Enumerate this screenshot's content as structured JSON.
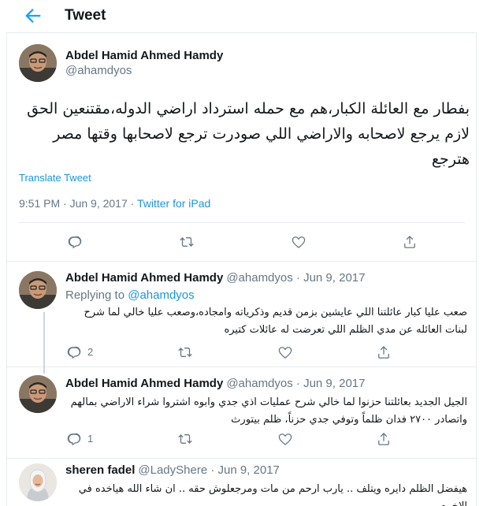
{
  "header": {
    "title": "Tweet"
  },
  "main_tweet": {
    "author_name": "Abdel Hamid Ahmed Hamdy",
    "author_handle": "@ahamdyos",
    "text": "بفطار مع العائلة الكبار،هم مع حمله استرداد اراضي الدوله،مقتنعين الحق لازم يرجع لاصحابه والاراضي اللي صودرت ترجع لاصحابها وقتها مصر هترجع",
    "translate_label": "Translate Tweet",
    "timestamp": "9:51 PM · Jun 9, 2017 · ",
    "source": "Twitter for iPad"
  },
  "replies": [
    {
      "author_name": "Abdel Hamid Ahmed Hamdy",
      "author_handle": "@ahamdyos",
      "date": " · Jun 9, 2017",
      "replying_prefix": "Replying to ",
      "replying_to": "@ahamdyos",
      "text": "صعب عليا كبار عائلتنا اللي عايشين بزمن قديم وذكرياته وامجاده،وصعب عليا خالي لما شرح لبنات العائله عن مدي الظلم اللي تعرضت له عائلات كتيره",
      "reply_count": "2"
    },
    {
      "author_name": "Abdel Hamid Ahmed Hamdy",
      "author_handle": "@ahamdyos",
      "date": " · Jun 9, 2017",
      "text": "الجيل الجديد بعائلتنا حزنوا لما خالي شرح عمليات اذي جدي وابوه اشتروا شراء الاراضي بمالهم واتصادر ٢٧٠٠ فدان ظلماً وتوفي جدي حزناً، ظلم بيتورث",
      "reply_count": "1"
    },
    {
      "author_name": "sheren fadel",
      "author_handle": "@LadyShere",
      "date": " · Jun 9, 2017",
      "text": "هيفضل الظلم دايره ويتلف .. يارب ارحم من مات ومرجعلوش حقه .. ان شاء الله هياخده في الاخره"
    }
  ],
  "icons": {
    "back": "back-arrow-icon",
    "reply": "reply-icon",
    "retweet": "retweet-icon",
    "like": "like-icon",
    "share": "share-icon"
  },
  "colors": {
    "accent": "#1da1f2",
    "link": "#1b95e0",
    "secondary_text": "#657786",
    "border": "#e6ecf0"
  }
}
